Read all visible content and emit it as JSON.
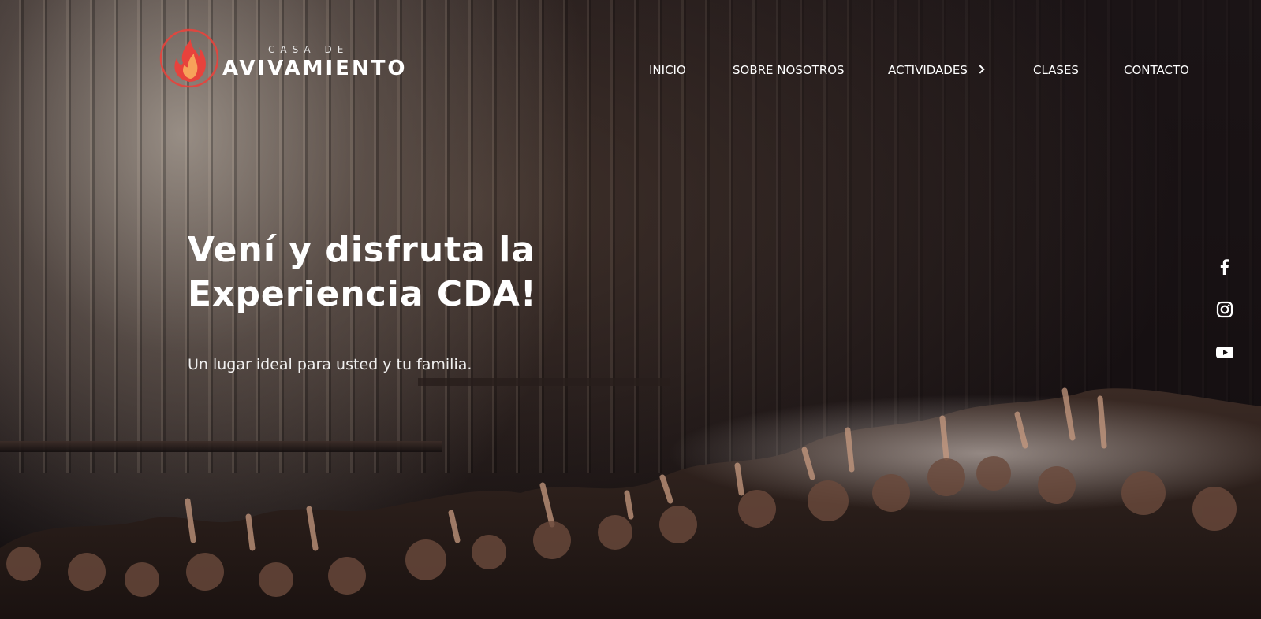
{
  "logo": {
    "top_text": "CASA DE",
    "main_text": "AVIVAMIENTO",
    "icon": "flame-icon",
    "colors": {
      "flame_outer": "#e8423c",
      "flame_inner": "#f7a25a"
    }
  },
  "nav": {
    "items": [
      {
        "label": "INICIO"
      },
      {
        "label": "SOBRE NOSOTROS"
      },
      {
        "label": "ACTIVIDADES",
        "icon": "chevron-right-icon"
      },
      {
        "label": "CLASES"
      },
      {
        "label": "CONTACTO"
      }
    ]
  },
  "hero": {
    "headline_line1": "Vení y disfruta la",
    "headline_line2": "Experiencia CDA!",
    "subheadline": "Un lugar ideal para usted y tu familia."
  },
  "social": {
    "items": [
      {
        "icon": "facebook-icon"
      },
      {
        "icon": "instagram-icon"
      },
      {
        "icon": "youtube-icon"
      }
    ]
  }
}
